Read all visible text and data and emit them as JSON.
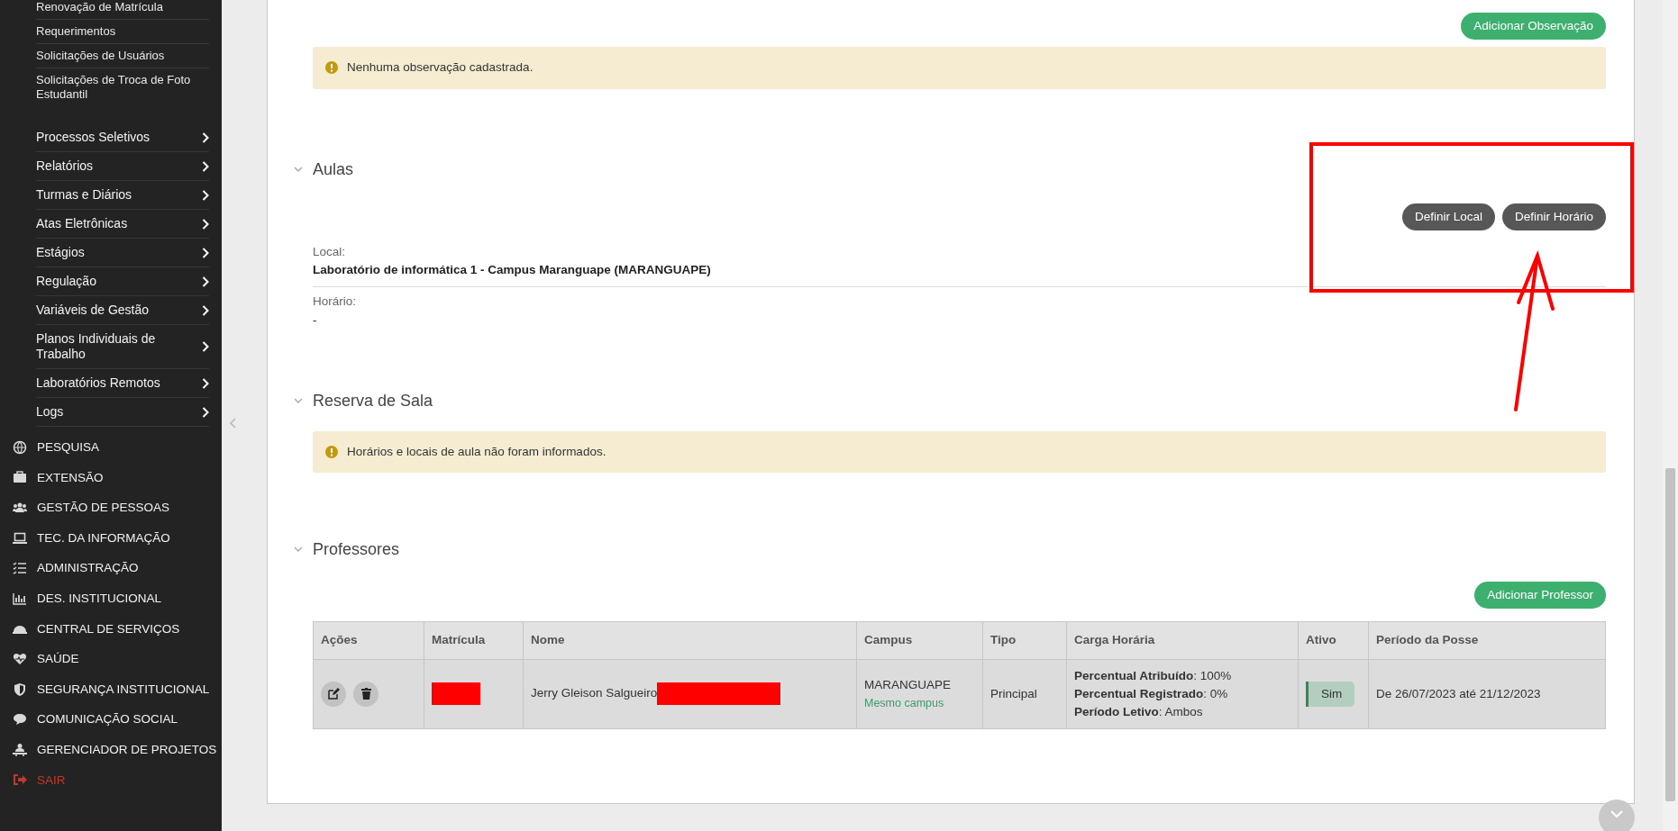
{
  "sidebar": {
    "subitems": [
      "Renovação de Matrícula",
      "Requerimentos",
      "Solicitações de Usuários",
      "Solicitações de Troca de Foto Estudantil"
    ],
    "menus": [
      "Processos Seletivos",
      "Relatórios",
      "Turmas e Diários",
      "Atas Eletrônicas",
      "Estágios",
      "Regulação",
      "Variáveis de Gestão",
      "Planos Individuais de Trabalho",
      "Laboratórios Remotos",
      "Logs"
    ],
    "modules": [
      {
        "label": "PESQUISA",
        "kind": "module"
      },
      {
        "label": "EXTENSÃO",
        "kind": "module"
      },
      {
        "label": "GESTÃO DE PESSOAS",
        "kind": "module"
      },
      {
        "label": "TEC. DA INFORMAÇÃO",
        "kind": "module"
      },
      {
        "label": "ADMINISTRAÇÃO",
        "kind": "module"
      },
      {
        "label": "DES. INSTITUCIONAL",
        "kind": "module"
      },
      {
        "label": "CENTRAL DE SERVIÇOS",
        "kind": "module"
      },
      {
        "label": "SAÚDE",
        "kind": "module"
      },
      {
        "label": "SEGURANÇA INSTITUCIONAL",
        "kind": "module"
      },
      {
        "label": "COMUNICAÇÃO SOCIAL",
        "kind": "module"
      },
      {
        "label": "GERENCIADOR DE PROJETOS",
        "kind": "module"
      },
      {
        "label": "SAIR",
        "kind": "logout"
      }
    ]
  },
  "observacoes": {
    "button": "Adicionar Observação",
    "alert": "Nenhuma observação cadastrada."
  },
  "aulas": {
    "title": "Aulas",
    "expanded": true,
    "buttons": [
      "Definir Local",
      "Definir Horário"
    ],
    "fields": [
      {
        "label": "Local:",
        "value": "Laboratório de informática 1 - Campus Maranguape (MARANGUAPE)"
      },
      {
        "label": "Horário:",
        "value": "-"
      }
    ]
  },
  "reserva": {
    "title": "Reserva de Sala",
    "expanded": true,
    "alert": "Horários e locais de aula não foram informados."
  },
  "professores": {
    "title": "Professores",
    "expanded": true,
    "button": "Adicionar Professor",
    "table": {
      "columns": [
        "Ações",
        "Matrícula",
        "Nome",
        "Campus",
        "Tipo",
        "Carga Horária",
        "Ativo",
        "Período da Posse"
      ],
      "rows": [
        {
          "nome": "Jerry Gleison Salgueiro",
          "campus": "MARANGUAPE",
          "campus_note": "Mesmo campus",
          "tipo": "Principal",
          "carga": [
            {
              "label": "Percentual Atribuído",
              "value": ": 100%"
            },
            {
              "label": "Percentual Registrado",
              "value": ": 0%"
            },
            {
              "label": "Período Letivo",
              "value": ": Ambos"
            }
          ],
          "ativo": "Sim",
          "periodo": "De 26/07/2023 até 21/12/2023"
        }
      ]
    }
  }
}
